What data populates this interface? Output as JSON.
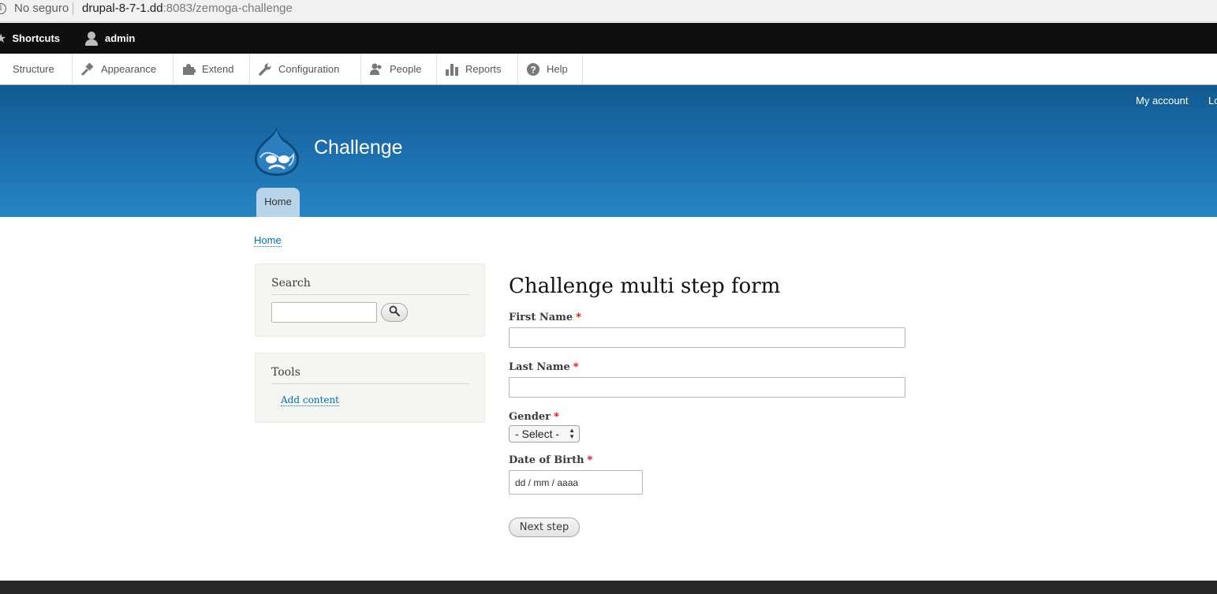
{
  "browser": {
    "security_label": "No seguro",
    "url_host": "drupal-8-7-1.dd",
    "url_rest": ":8083/zemoga-challenge"
  },
  "toolbar": {
    "shortcuts_label": "Shortcuts",
    "user_label": "admin"
  },
  "tray": {
    "items": [
      {
        "label": "Structure",
        "icon": "structure-icon"
      },
      {
        "label": "Appearance",
        "icon": "appearance-icon"
      },
      {
        "label": "Extend",
        "icon": "extend-icon"
      },
      {
        "label": "Configuration",
        "icon": "configuration-icon"
      },
      {
        "label": "People",
        "icon": "people-icon"
      },
      {
        "label": "Reports",
        "icon": "reports-icon"
      },
      {
        "label": "Help",
        "icon": "help-icon"
      }
    ]
  },
  "header": {
    "site_name": "Challenge",
    "secondary_menu": [
      "My account",
      "Lo"
    ],
    "main_menu": [
      "Home"
    ],
    "gradient_top": "#125a91",
    "gradient_bottom": "#2785c4"
  },
  "breadcrumb": [
    "Home"
  ],
  "sidebar": {
    "search_block": {
      "title": "Search",
      "input_value": "",
      "button_icon": "search-icon"
    },
    "tools_block": {
      "title": "Tools",
      "links": [
        "Add content"
      ]
    }
  },
  "form": {
    "title": "Challenge multi step form",
    "required_marker": "*",
    "fields": {
      "first_name": {
        "label": "First Name",
        "value": ""
      },
      "last_name": {
        "label": "Last Name",
        "value": ""
      },
      "gender": {
        "label": "Gender",
        "selected": "- Select -"
      },
      "date_of_birth": {
        "label": "Date of Birth",
        "placeholder": "dd / mm / aaaa"
      }
    },
    "submit_label": "Next step"
  },
  "colors": {
    "link": "#0071b3",
    "required": "#e00000",
    "toolbar_bg": "#0f0f0f",
    "footer_bg": "#292929"
  }
}
